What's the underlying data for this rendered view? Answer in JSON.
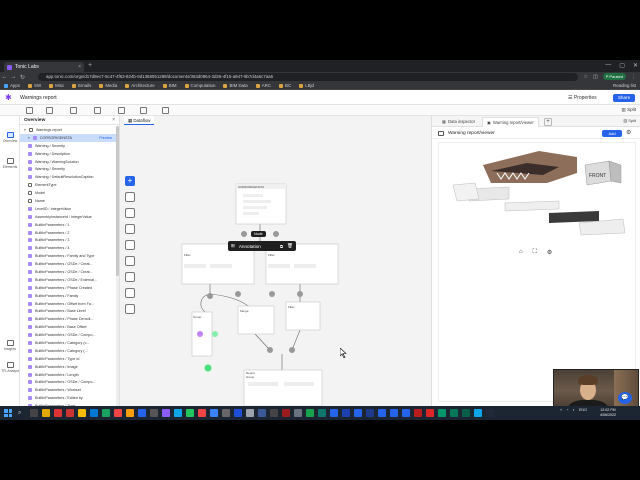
{
  "browser": {
    "tab_title": "Tonic Labs",
    "new_tab": "+",
    "url": "app.tonic.com/orgs/d17d8ec7-5c47-4f63-824b-9d1368051288/documents/363d0964-3d26-4f15-a947-9b7d4a6c7aa5",
    "profile_initial": "P",
    "profile_label": "Paused",
    "bookmarks": [
      "Apps",
      "SW",
      "Misc",
      "Emails",
      "Media",
      "Architecture",
      "BIM",
      "Computation",
      "BIM Data",
      "ARC",
      "BC",
      "LBjd"
    ],
    "reading_list": "Reading list"
  },
  "app": {
    "title": "Warnings report",
    "properties_label": "Properties",
    "share_label": "Share",
    "split_label": "Split"
  },
  "rail": {
    "items": [
      "Overview",
      "Elements"
    ],
    "bottom_items": [
      "Insights",
      "TFLAnalyst"
    ]
  },
  "overview": {
    "header": "Overview",
    "root": "Warnings report",
    "selected": "CORSORIGENSTA",
    "selected_badge": "Preview",
    "rows": [
      "Warning / Severity",
      "Warning / Description",
      "Warning / WarningSolution",
      "Warning / Severity",
      "Warning / DefaultResolutionCaption",
      "ElementType",
      "Model",
      "Name",
      "LevelID / IntegerValue",
      "AssemblyInstanceId / IntegerValue",
      "BuiltInParameters / 1",
      "BuiltInParameters / 2",
      "BuiltInParameters / 3",
      "BuiltInParameters / 4",
      "BuiltInParameters / Family and Type",
      "BuiltInParameters / OSDe / Creat...",
      "BuiltInParameters / OSDe / Creat...",
      "BuiltInParameters / OSDe / External...",
      "BuiltInParameters / Phase Created",
      "BuiltInParameters / Family",
      "BuiltInParameters / Offset from Fa...",
      "BuiltInParameters / Base Level",
      "BuiltInParameters / Phase Demoli...",
      "BuiltInParameters / Base Offset",
      "BuiltInParameters / OSDe / Compo...",
      "BuiltInParameters / Category (c...",
      "BuiltInParameters / Category (...",
      "BuiltInParameters / Type Id",
      "BuiltInParameters / Image",
      "BuiltInParameters / Length",
      "BuiltInParameters / OSDe / Compo...",
      "BuiltInParameters / Workset",
      "BuiltInParameters / Edited by",
      "BuiltInParameters / Type"
    ]
  },
  "canvas": {
    "tab_label": "Dataflow",
    "annotation_label": "Annotation",
    "annotation_tip": "Node",
    "node_titles": [
      "CORSORIGENSTA",
      "Filter",
      "Filter",
      "Group",
      "Merge",
      "Filter",
      "Group",
      "Table",
      "Union",
      "Report"
    ]
  },
  "viewer": {
    "tabs": [
      "Data inspector",
      "Warning report/viewer"
    ],
    "title": "Warning report/viewer",
    "add_label": "Add",
    "model_text": "FRONT"
  },
  "taskbar": {
    "lang": "ENG",
    "time": "12:02 PM",
    "date": "4/06/2022"
  }
}
